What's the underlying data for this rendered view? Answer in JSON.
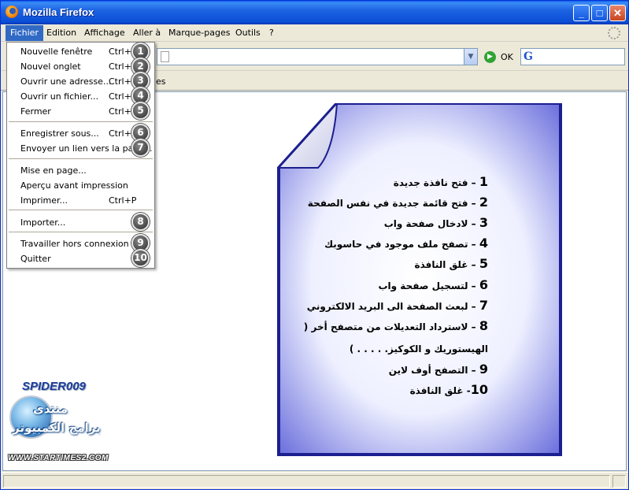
{
  "window": {
    "title": "Mozilla Firefox"
  },
  "menubar": {
    "items": [
      "Fichier",
      "Edition",
      "Affichage",
      "Aller à",
      "Marque-pages",
      "Outils",
      "?"
    ]
  },
  "navbar": {
    "go_label": "OK",
    "bookmarks_fragment": "es"
  },
  "file_menu": {
    "items": [
      {
        "label": "Nouvelle fenêtre",
        "shortcut": "Ctrl+N",
        "badge": "1"
      },
      {
        "label": "Nouvel onglet",
        "shortcut": "Ctrl+T",
        "badge": "2"
      },
      {
        "label": "Ouvrir une adresse...",
        "shortcut": "Ctrl+L",
        "badge": "3"
      },
      {
        "label": "Ouvrir un fichier...",
        "shortcut": "Ctrl+O",
        "badge": "4"
      },
      {
        "label": "Fermer",
        "shortcut": "Ctrl+W",
        "badge": "5"
      },
      {
        "label": "Enregistrer sous...",
        "shortcut": "Ctrl+S",
        "badge": "6"
      },
      {
        "label": "Envoyer un lien vers la page...",
        "shortcut": "",
        "badge": "7"
      },
      {
        "label": "Mise en page...",
        "shortcut": "",
        "badge": ""
      },
      {
        "label": "Aperçu avant impression",
        "shortcut": "",
        "badge": ""
      },
      {
        "label": "Imprimer...",
        "shortcut": "Ctrl+P",
        "badge": ""
      },
      {
        "label": "Importer...",
        "shortcut": "",
        "badge": "8"
      },
      {
        "label": "Travailler hors connexion",
        "shortcut": "",
        "badge": "9"
      },
      {
        "label": "Quitter",
        "shortcut": "",
        "badge": "10"
      }
    ]
  },
  "document": {
    "lines": [
      {
        "num": "1",
        "sep": " – ",
        "text": "فتح نافذة جديدة"
      },
      {
        "num": "2",
        "sep": " – ",
        "text": "فتح قائمة جديدة في نفس الصفحة"
      },
      {
        "num": "3",
        "sep": " – ",
        "text": "لادخال صفحة واب"
      },
      {
        "num": "4",
        "sep": " – ",
        "text": "تصفح ملف موجود في حاسوبك"
      },
      {
        "num": "5",
        "sep": " – ",
        "text": "غلق النافذة"
      },
      {
        "num": "6",
        "sep": " – ",
        "text": "لتسجيل صفحة واب"
      },
      {
        "num": "7",
        "sep": " – ",
        "text": "لبعث الصفحة الى البريد الالكتروني"
      },
      {
        "num": "8",
        "sep": " – ",
        "text": "لاسترداد التعديلات من متصفح أخر ("
      },
      {
        "num": "",
        "sep": "",
        "text": "الهيستوريك و الكوكيز. . . . . )"
      },
      {
        "num": "9",
        "sep": " – ",
        "text": "التصفح أوف لاين"
      },
      {
        "num": "10",
        "sep": "- ",
        "text": "غلق النافذة"
      }
    ]
  },
  "logo": {
    "title": "SPIDER009",
    "arabic_top": "منتدى",
    "arabic_bottom": "برامج الكمبيوتر",
    "url": "WWW.STARTIMES2.COM"
  }
}
